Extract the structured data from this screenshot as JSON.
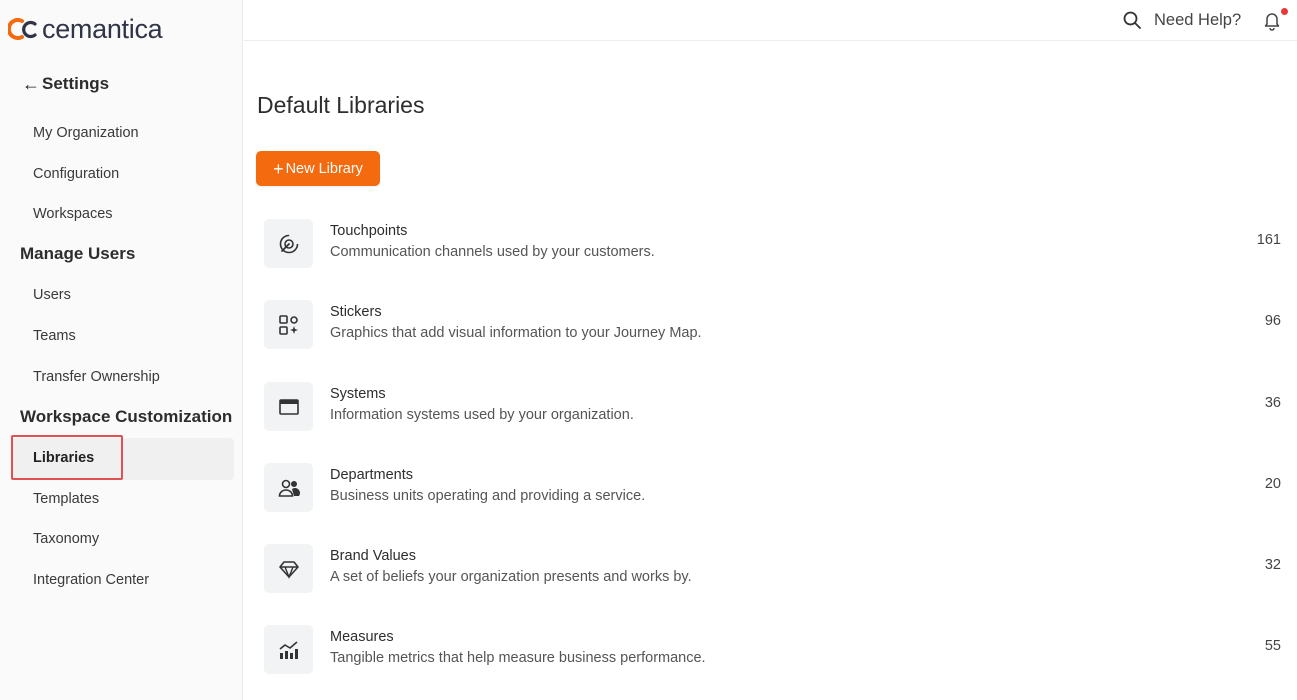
{
  "brand": {
    "name": "cemantica",
    "accent": "#f46a0f"
  },
  "sidebar": {
    "back_label": "Settings",
    "items": [
      {
        "label": "My Organization"
      },
      {
        "label": "Configuration"
      },
      {
        "label": "Workspaces"
      }
    ],
    "sections": [
      {
        "title": "Manage Users",
        "items": [
          {
            "label": "Users"
          },
          {
            "label": "Teams"
          },
          {
            "label": "Transfer Ownership"
          }
        ]
      },
      {
        "title": "Workspace Customization",
        "items": [
          {
            "label": "Libraries"
          },
          {
            "label": "Templates"
          },
          {
            "label": "Taxonomy"
          },
          {
            "label": "Integration Center"
          }
        ]
      }
    ],
    "active_item": "Libraries"
  },
  "topbar": {
    "search_icon": "search-icon",
    "help_label": "Need Help?",
    "bell_icon": "bell-icon"
  },
  "main": {
    "title": "Default Libraries",
    "new_button_label": "New Library",
    "libraries": [
      {
        "name": "Touchpoints",
        "description": "Communication channels used by your customers.",
        "count": "161",
        "icon": "touchpoint-icon"
      },
      {
        "name": "Stickers",
        "description": "Graphics that add visual information to your Journey Map.",
        "count": "96",
        "icon": "sticker-icon"
      },
      {
        "name": "Systems",
        "description": "Information systems used by your organization.",
        "count": "36",
        "icon": "browser-window-icon"
      },
      {
        "name": "Departments",
        "description": "Business units operating and providing a service.",
        "count": "20",
        "icon": "people-icon"
      },
      {
        "name": "Brand Values",
        "description": "A set of beliefs your organization presents and works by.",
        "count": "32",
        "icon": "diamond-icon"
      },
      {
        "name": "Measures",
        "description": "Tangible metrics that help measure business performance.",
        "count": "55",
        "icon": "chart-icon"
      }
    ]
  }
}
